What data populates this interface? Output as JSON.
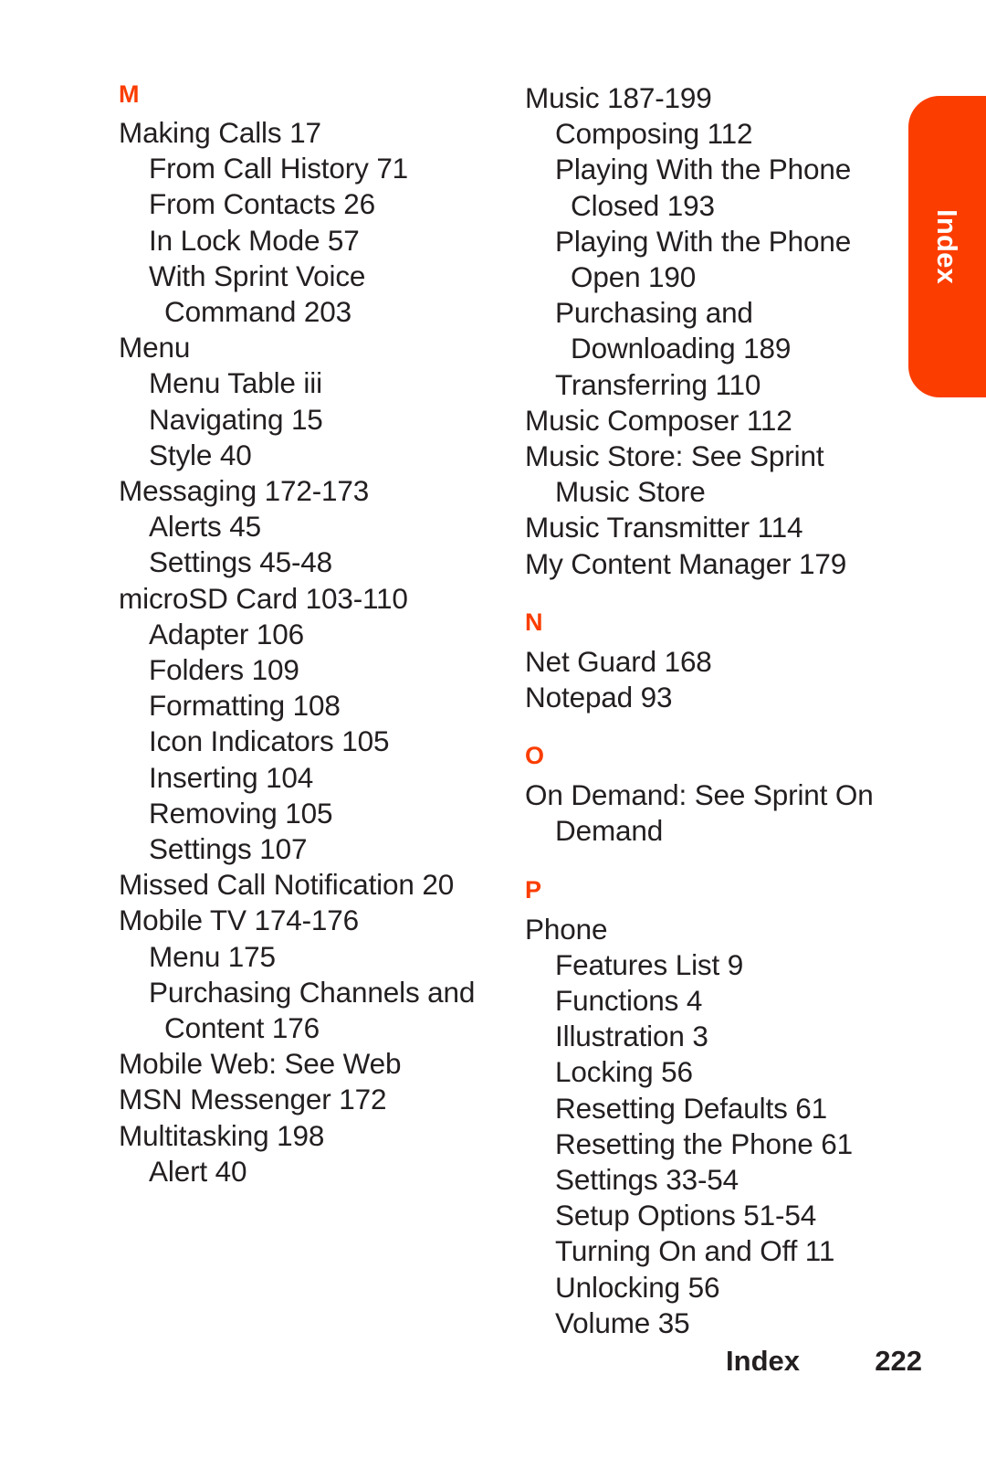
{
  "page": {
    "footer_label": "Index",
    "footer_page": "222",
    "tab_label": "Index",
    "accent_color": "#fb3d00",
    "text_color": "#231f20"
  },
  "left_column": {
    "sections": [
      {
        "letter": "M",
        "entries": [
          {
            "level": 0,
            "text": "Making Calls 17"
          },
          {
            "level": 1,
            "text": "From Call History 71"
          },
          {
            "level": 1,
            "text": "From Contacts 26"
          },
          {
            "level": 1,
            "text": "In Lock Mode 57"
          },
          {
            "level": 1,
            "text": "With Sprint Voice"
          },
          {
            "level": 2,
            "text": "Command 203"
          },
          {
            "level": 0,
            "text": "Menu"
          },
          {
            "level": 1,
            "text": "Menu Table iii"
          },
          {
            "level": 1,
            "text": "Navigating 15"
          },
          {
            "level": 1,
            "text": "Style 40"
          },
          {
            "level": 0,
            "text": "Messaging 172-173"
          },
          {
            "level": 1,
            "text": "Alerts 45"
          },
          {
            "level": 1,
            "text": "Settings 45-48"
          },
          {
            "level": 0,
            "text": "microSD Card 103-110"
          },
          {
            "level": 1,
            "text": "Adapter 106"
          },
          {
            "level": 1,
            "text": "Folders 109"
          },
          {
            "level": 1,
            "text": "Formatting 108"
          },
          {
            "level": 1,
            "text": "Icon Indicators 105"
          },
          {
            "level": 1,
            "text": "Inserting 104"
          },
          {
            "level": 1,
            "text": "Removing 105"
          },
          {
            "level": 1,
            "text": "Settings 107"
          },
          {
            "level": 0,
            "text": "Missed Call Notification 20"
          },
          {
            "level": 0,
            "text": "Mobile TV 174-176"
          },
          {
            "level": 1,
            "text": "Menu 175"
          },
          {
            "level": 1,
            "text": "Purchasing Channels and"
          },
          {
            "level": 2,
            "text": "Content 176"
          },
          {
            "level": 0,
            "text": "Mobile Web: See Web"
          },
          {
            "level": 0,
            "text": "MSN Messenger 172"
          },
          {
            "level": 0,
            "text": "Multitasking 198"
          },
          {
            "level": 1,
            "text": "Alert 40"
          }
        ]
      }
    ]
  },
  "right_column": {
    "sections": [
      {
        "letter": null,
        "entries": [
          {
            "level": 0,
            "text": "Music 187-199"
          },
          {
            "level": 1,
            "text": "Composing 112"
          },
          {
            "level": 1,
            "text": "Playing With the Phone"
          },
          {
            "level": 2,
            "text": "Closed 193"
          },
          {
            "level": 1,
            "text": "Playing With the Phone"
          },
          {
            "level": 2,
            "text": "Open 190"
          },
          {
            "level": 1,
            "text": "Purchasing and"
          },
          {
            "level": 2,
            "text": "Downloading 189"
          },
          {
            "level": 1,
            "text": "Transferring 110"
          },
          {
            "level": 0,
            "text": "Music Composer 112"
          },
          {
            "level": 0,
            "text": "Music Store: See Sprint"
          },
          {
            "level": 1,
            "text": "Music Store"
          },
          {
            "level": 0,
            "text": "Music Transmitter 114"
          },
          {
            "level": 0,
            "text": "My Content Manager 179"
          }
        ]
      },
      {
        "letter": "N",
        "entries": [
          {
            "level": 0,
            "text": "Net Guard 168"
          },
          {
            "level": 0,
            "text": "Notepad 93"
          }
        ]
      },
      {
        "letter": "O",
        "entries": [
          {
            "level": 0,
            "text": "On Demand: See Sprint On"
          },
          {
            "level": 1,
            "text": "Demand"
          }
        ]
      },
      {
        "letter": "P",
        "entries": [
          {
            "level": 0,
            "text": "Phone"
          },
          {
            "level": 1,
            "text": "Features List 9"
          },
          {
            "level": 1,
            "text": "Functions 4"
          },
          {
            "level": 1,
            "text": "Illustration 3"
          },
          {
            "level": 1,
            "text": "Locking 56"
          },
          {
            "level": 1,
            "text": "Resetting Defaults 61"
          },
          {
            "level": 1,
            "text": "Resetting the Phone 61"
          },
          {
            "level": 1,
            "text": "Settings 33-54"
          },
          {
            "level": 1,
            "text": "Setup Options 51-54"
          },
          {
            "level": 1,
            "text": "Turning On and Off 11"
          },
          {
            "level": 1,
            "text": "Unlocking 56"
          },
          {
            "level": 1,
            "text": "Volume 35"
          }
        ]
      }
    ]
  }
}
